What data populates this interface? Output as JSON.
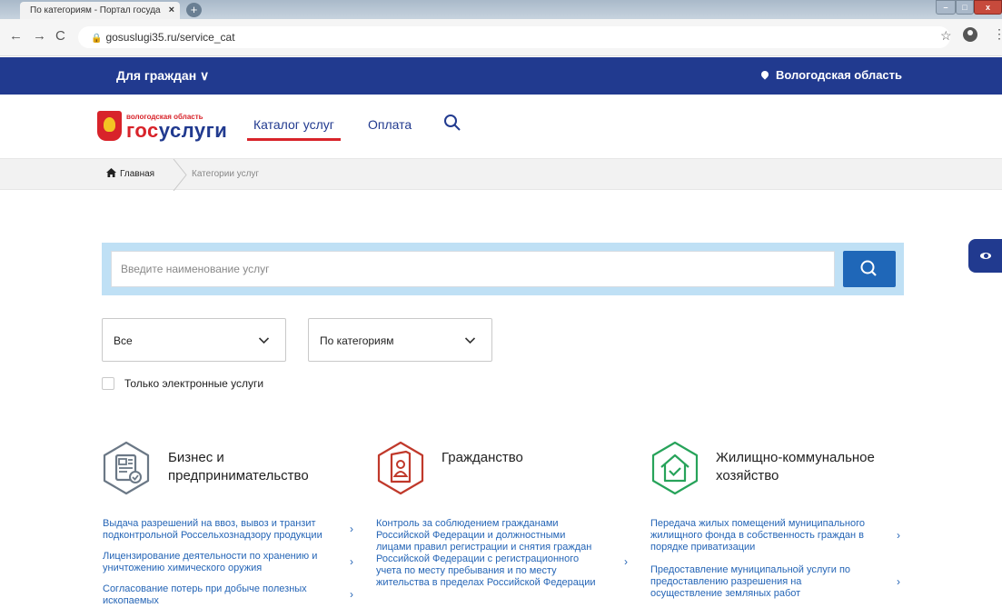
{
  "browser": {
    "tab_title": "По категориям - Портал госуда",
    "tab_close": "×",
    "new_tab": "+",
    "url": "gosuslugi35.ru/service_cat"
  },
  "topbar": {
    "audience": "Для граждан ∨",
    "region": "Вологодская область"
  },
  "header": {
    "logo_region": "вологодская область",
    "logo_part1": "гос",
    "logo_part2": "услуги",
    "nav_catalog": "Каталог услуг",
    "nav_payment": "Оплата"
  },
  "breadcrumb": {
    "home": "Главная",
    "current": "Категории услуг"
  },
  "search": {
    "placeholder": "Введите наименование услуг"
  },
  "filters": {
    "scope": "Все",
    "grouping": "По категориям",
    "electronic_only": "Только электронные услуги",
    "electronic_only_checked": false
  },
  "categories": [
    {
      "title_line1": "Бизнес и",
      "title_line2": "предпринимательство",
      "icon": "business-document-icon",
      "services": [
        {
          "line1": "Выдача разрешений на ввоз, вывоз и транзит",
          "line2": "подконтрольной Россельхознадзору продукции"
        },
        {
          "line1": "Лицензирование деятельности по хранению и",
          "line2": "уничтожению химического оружия"
        },
        {
          "line1": "Согласование потерь при добыче полезных",
          "line2": "ископаемых"
        }
      ]
    },
    {
      "title_line1": "Гражданство",
      "title_line2": "",
      "icon": "passport-icon",
      "services": [
        {
          "line1": "Контроль за соблюдением гражданами",
          "line2": "Российской Федерации и должностными",
          "line3": "лицами правил регистрации и снятия граждан",
          "line4": "Российской Федерации с регистрационного",
          "line5": "учета по месту пребывания и по месту",
          "line6": "жительства в пределах Российской Федерации"
        }
      ]
    },
    {
      "title_line1": "Жилищно-коммунальное",
      "title_line2": "хозяйство",
      "icon": "house-check-icon",
      "services": [
        {
          "line1": "Передача жилых помещений муниципального",
          "line2": "жилищного фонда в собственность граждан в",
          "line3": "порядке приватизации"
        },
        {
          "line1": "Предоставление муниципальной услуги по",
          "line2": "предоставлению разрешения на",
          "line3": "осуществление земляных работ"
        }
      ]
    }
  ],
  "colors": {
    "brand_blue": "#213a8f",
    "brand_red": "#d8232a",
    "link_blue": "#2565b6",
    "search_band": "#bfe0f5",
    "icon_gray": "#6b7886",
    "icon_red": "#c0392b",
    "icon_green": "#27a35a"
  }
}
